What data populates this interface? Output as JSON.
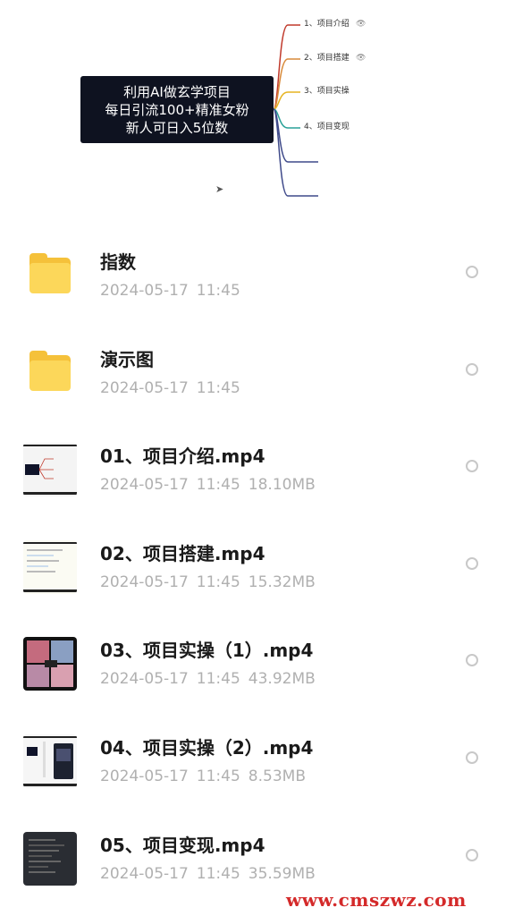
{
  "banner": {
    "root_lines": [
      "利用AI做玄学项目",
      "每日引流100+精准女粉",
      "新人可日入5位数"
    ],
    "branches": [
      {
        "label": "1、项目介绍",
        "color": "#c0392b",
        "icon": "👁"
      },
      {
        "label": "2、项目搭建",
        "color": "#d98a3a",
        "icon": "👁"
      },
      {
        "label": "3、项目实操",
        "color": "#e6b422",
        "icon": ""
      },
      {
        "label": "4、项目变现",
        "color": "#2aa198",
        "icon": ""
      },
      {
        "label": "",
        "color": "#3f4a8a",
        "icon": ""
      },
      {
        "label": "",
        "color": "#3f4a8a",
        "icon": ""
      }
    ]
  },
  "files": [
    {
      "name": "指数",
      "date": "2024-05-17",
      "time": "11:45",
      "size": "",
      "type": "folder"
    },
    {
      "name": "演示图",
      "date": "2024-05-17",
      "time": "11:45",
      "size": "",
      "type": "folder"
    },
    {
      "name": "01、项目介绍.mp4",
      "date": "2024-05-17",
      "time": "11:45",
      "size": "18.10MB",
      "type": "video"
    },
    {
      "name": "02、项目搭建.mp4",
      "date": "2024-05-17",
      "time": "11:45",
      "size": "15.32MB",
      "type": "video"
    },
    {
      "name": "03、项目实操（1）.mp4",
      "date": "2024-05-17",
      "time": "11:45",
      "size": "43.92MB",
      "type": "video"
    },
    {
      "name": "04、项目实操（2）.mp4",
      "date": "2024-05-17",
      "time": "11:45",
      "size": "8.53MB",
      "type": "video"
    },
    {
      "name": "05、项目变现.mp4",
      "date": "2024-05-17",
      "time": "11:45",
      "size": "35.59MB",
      "type": "video"
    }
  ],
  "watermark": "www.cmszwz.com"
}
